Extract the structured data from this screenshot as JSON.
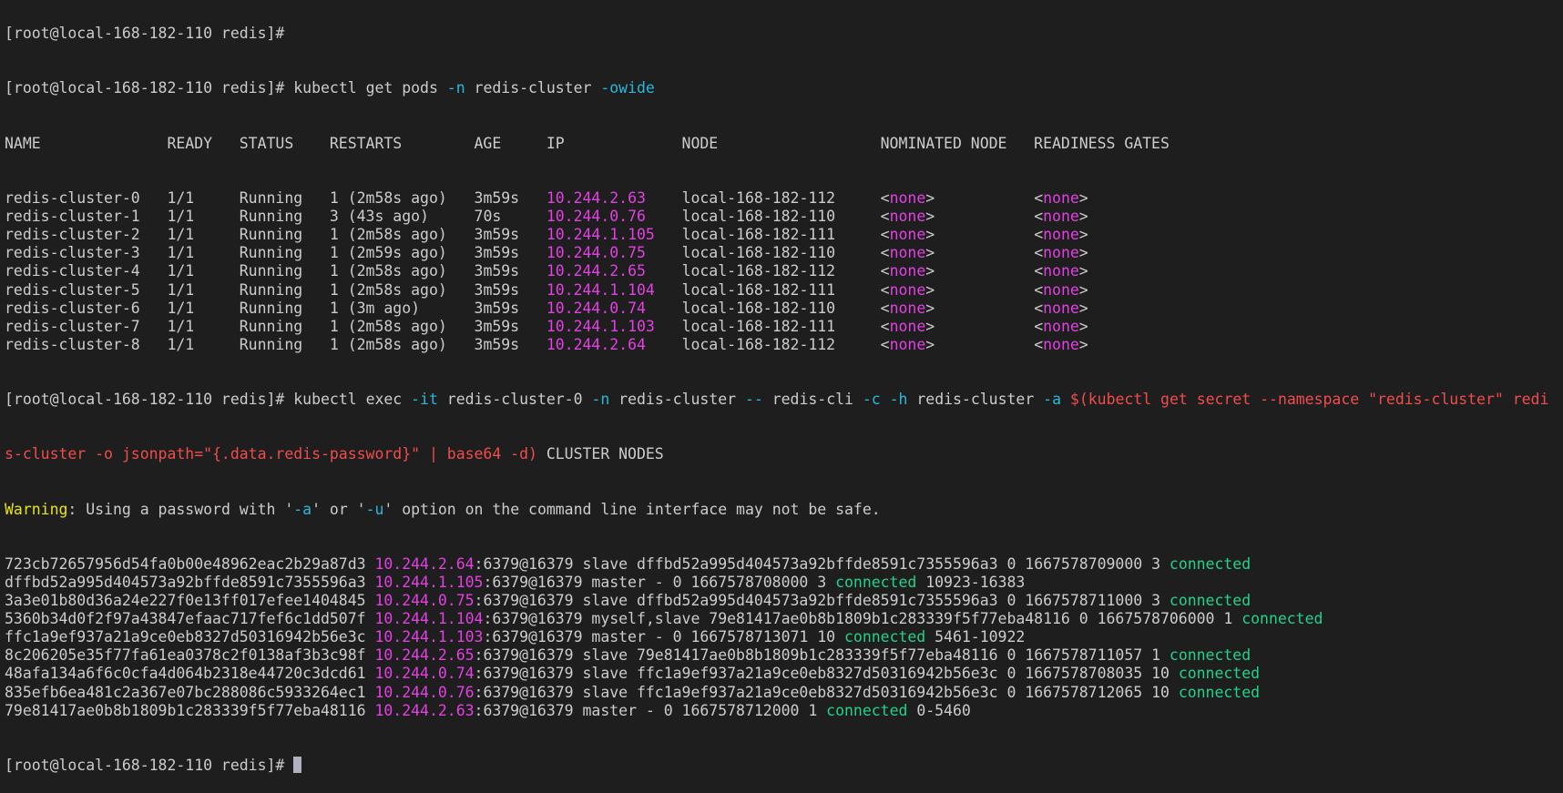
{
  "colors": {
    "background": "#1e1e1e",
    "foreground": "#cccccc",
    "ip": "#e340e3",
    "connected": "#23d18b",
    "flag": "#29b8db",
    "subshell": "#f14c4c",
    "warning": "#e5e510"
  },
  "prompt": "[root@local-168-182-110 redis]#",
  "partial_top_line": "[root@local-168-182-110 redis]#",
  "cmd1": {
    "pre": " kubectl get pods ",
    "flag_n": "-n",
    "mid": " redis-cluster ",
    "flag_o": "-owide"
  },
  "pods_header": "NAME              READY   STATUS    RESTARTS        AGE     IP             NODE                  NOMINATED NODE   READINESS GATES",
  "pods": [
    {
      "name": "redis-cluster-0",
      "ready": "1/1",
      "status": "Running",
      "restarts": "1 (2m58s ago)",
      "age": "3m59s",
      "ip": "10.244.2.63",
      "node": "local-168-182-112",
      "nominated": "none",
      "gates": "none"
    },
    {
      "name": "redis-cluster-1",
      "ready": "1/1",
      "status": "Running",
      "restarts": "3 (43s ago)",
      "age": "70s",
      "ip": "10.244.0.76",
      "node": "local-168-182-110",
      "nominated": "none",
      "gates": "none"
    },
    {
      "name": "redis-cluster-2",
      "ready": "1/1",
      "status": "Running",
      "restarts": "1 (2m58s ago)",
      "age": "3m59s",
      "ip": "10.244.1.105",
      "node": "local-168-182-111",
      "nominated": "none",
      "gates": "none"
    },
    {
      "name": "redis-cluster-3",
      "ready": "1/1",
      "status": "Running",
      "restarts": "1 (2m59s ago)",
      "age": "3m59s",
      "ip": "10.244.0.75",
      "node": "local-168-182-110",
      "nominated": "none",
      "gates": "none"
    },
    {
      "name": "redis-cluster-4",
      "ready": "1/1",
      "status": "Running",
      "restarts": "1 (2m58s ago)",
      "age": "3m59s",
      "ip": "10.244.2.65",
      "node": "local-168-182-112",
      "nominated": "none",
      "gates": "none"
    },
    {
      "name": "redis-cluster-5",
      "ready": "1/1",
      "status": "Running",
      "restarts": "1 (2m58s ago)",
      "age": "3m59s",
      "ip": "10.244.1.104",
      "node": "local-168-182-111",
      "nominated": "none",
      "gates": "none"
    },
    {
      "name": "redis-cluster-6",
      "ready": "1/1",
      "status": "Running",
      "restarts": "1 (3m ago)",
      "age": "3m59s",
      "ip": "10.244.0.74",
      "node": "local-168-182-110",
      "nominated": "none",
      "gates": "none"
    },
    {
      "name": "redis-cluster-7",
      "ready": "1/1",
      "status": "Running",
      "restarts": "1 (2m58s ago)",
      "age": "3m59s",
      "ip": "10.244.1.103",
      "node": "local-168-182-111",
      "nominated": "none",
      "gates": "none"
    },
    {
      "name": "redis-cluster-8",
      "ready": "1/1",
      "status": "Running",
      "restarts": "1 (2m58s ago)",
      "age": "3m59s",
      "ip": "10.244.2.64",
      "node": "local-168-182-112",
      "nominated": "none",
      "gates": "none"
    }
  ],
  "cmd2": {
    "p1": " kubectl exec ",
    "flag_it": "-it",
    "p2": " redis-cluster-0 ",
    "flag_n": "-n",
    "p3": " redis-cluster ",
    "flag_dd": "--",
    "p4": " redis-cli ",
    "flag_c": "-c",
    "sp1": " ",
    "flag_h": "-h",
    "p5": " redis-cluster ",
    "flag_a": "-a",
    "sp2": " ",
    "sub1": "$(kubectl get secret --namespace \"redis-cluster\" redi",
    "sub2": "s-cluster -o jsonpath=\"{.data.redis-password}\" | base64 -d)",
    "tail": " CLUSTER NODES"
  },
  "warning": {
    "label": "Warning",
    "t1": ": Using a password with '",
    "f1": "-a",
    "t2": "' or '",
    "f2": "-u",
    "t3": "' option on the command line interface may not be safe."
  },
  "nodes": [
    {
      "id": "723cb72657956d54fa0b00e48962eac2b29a87d3",
      "ip": "10.244.2.64",
      "rest": ":6379@16379 slave dffbd52a995d404573a92bffde8591c7355596a3 0 1667578709000 3 ",
      "state": "connected",
      "slots": ""
    },
    {
      "id": "dffbd52a995d404573a92bffde8591c7355596a3",
      "ip": "10.244.1.105",
      "rest": ":6379@16379 master - 0 1667578708000 3 ",
      "state": "connected",
      "slots": " 10923-16383"
    },
    {
      "id": "3a3e01b80d36a24e227f0e13ff017efee1404845",
      "ip": "10.244.0.75",
      "rest": ":6379@16379 slave dffbd52a995d404573a92bffde8591c7355596a3 0 1667578711000 3 ",
      "state": "connected",
      "slots": ""
    },
    {
      "id": "5360b34d0f2f97a43847efaac717fef6c1dd507f",
      "ip": "10.244.1.104",
      "rest": ":6379@16379 myself,slave 79e81417ae0b8b1809b1c283339f5f77eba48116 0 1667578706000 1 ",
      "state": "connected",
      "slots": ""
    },
    {
      "id": "ffc1a9ef937a21a9ce0eb8327d50316942b56e3c",
      "ip": "10.244.1.103",
      "rest": ":6379@16379 master - 0 1667578713071 10 ",
      "state": "connected",
      "slots": " 5461-10922"
    },
    {
      "id": "8c206205e35f77fa61ea0378c2f0138af3b3c98f",
      "ip": "10.244.2.65",
      "rest": ":6379@16379 slave 79e81417ae0b8b1809b1c283339f5f77eba48116 0 1667578711057 1 ",
      "state": "connected",
      "slots": ""
    },
    {
      "id": "48afa134a6f6c0cfa4d064b2318e44720c3dcd61",
      "ip": "10.244.0.74",
      "rest": ":6379@16379 slave ffc1a9ef937a21a9ce0eb8327d50316942b56e3c 0 1667578708035 10 ",
      "state": "connected",
      "slots": ""
    },
    {
      "id": "835efb6ea481c2a367e07bc288086c5933264ec1",
      "ip": "10.244.0.76",
      "rest": ":6379@16379 slave ffc1a9ef937a21a9ce0eb8327d50316942b56e3c 0 1667578712065 10 ",
      "state": "connected",
      "slots": ""
    },
    {
      "id": "79e81417ae0b8b1809b1c283339f5f77eba48116",
      "ip": "10.244.2.63",
      "rest": ":6379@16379 master - 0 1667578712000 1 ",
      "state": "connected",
      "slots": " 0-5460"
    }
  ],
  "final_prompt": "[root@local-168-182-110 redis]# "
}
